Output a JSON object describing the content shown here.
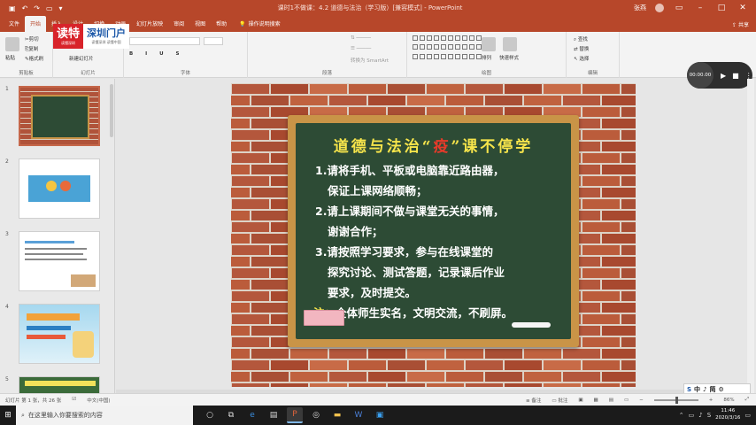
{
  "window": {
    "title": "课时1不做课：4.2 道德与法治（学习版）[兼容模式] - PowerPoint",
    "user_name": "张燕",
    "share": "共享"
  },
  "ribbon_tabs": [
    "文件",
    "开始",
    "插入",
    "设计",
    "切换",
    "动画",
    "幻灯片放映",
    "审阅",
    "视图",
    "帮助"
  ],
  "ribbon_active_tab": "开始",
  "tell_me": "操作说明搜索",
  "ribbon": {
    "clipboard": {
      "paste": "粘贴",
      "cut": "剪切",
      "copy": "复制",
      "format_painter": "格式刷",
      "label": "剪贴板"
    },
    "slides": {
      "new_slide": "新建幻灯片",
      "label": "幻灯片"
    },
    "font_label": "字体",
    "paragraph_label": "段落",
    "drawing": {
      "arrange": "排列",
      "quick_styles": "快速样式",
      "label": "绘图"
    },
    "editing": {
      "find": "查找",
      "replace": "替换",
      "select": "选择",
      "label": "编辑"
    },
    "smartart": "转换为 SmartArt"
  },
  "logo": {
    "brand_left": "读特",
    "brand_left_sub": "读懂深圳",
    "brand_right": "深圳门户",
    "brand_right_sub": "读懂深圳 读懂中国"
  },
  "thumbnails": [
    {
      "num": "1",
      "selected": true
    },
    {
      "num": "2",
      "selected": false
    },
    {
      "num": "3",
      "selected": false
    },
    {
      "num": "4",
      "selected": false
    },
    {
      "num": "5",
      "selected": false
    }
  ],
  "slide": {
    "title_part1": "道德与法治“",
    "title_red": "疫",
    "title_part2": "”课不停学",
    "lines": [
      "1.请将手机、平板或电脑靠近路由器，",
      "保证上课网络顺畅；",
      "2.请上课期间不做与课堂无关的事情，",
      "谢谢合作；",
      "3.请按照学习要求，参与在线课堂的",
      "探究讨论、测试答题，记录课后作业",
      "要求，及时提交。"
    ],
    "note_label": "注：",
    "note_text": "全体师生实名，文明交流，不刷屏。"
  },
  "media": {
    "time": "00:00.00"
  },
  "ime": {
    "items": [
      "中",
      "♪",
      "简",
      "⚙"
    ]
  },
  "status": {
    "slide_info": "幻灯片 第 1 张，共 26 张",
    "language": "中文(中国)",
    "notes": "备注",
    "comments": "批注",
    "zoom": "86%"
  },
  "taskbar": {
    "search_placeholder": "在这里输入你要搜索的内容",
    "time": "11:46",
    "date": "2020/3/16"
  }
}
